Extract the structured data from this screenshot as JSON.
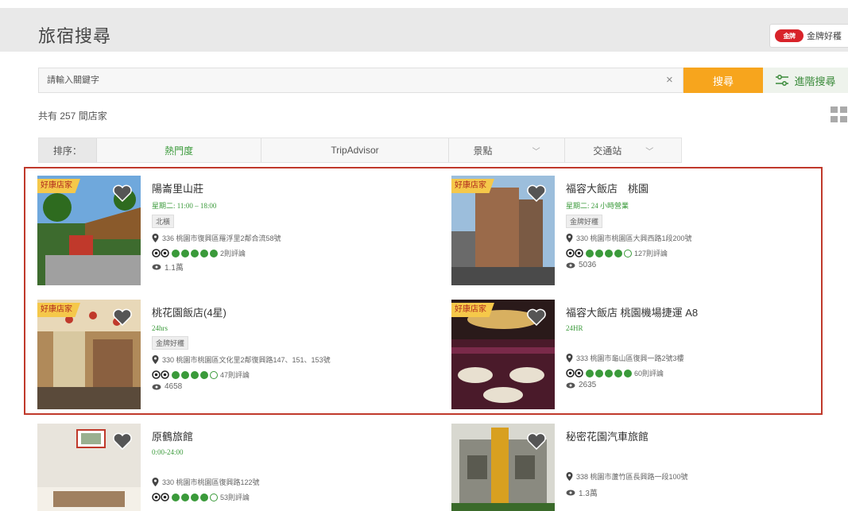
{
  "header": {
    "title": "旅宿搜尋",
    "brand_label": "金牌好穫",
    "brand_logo_text": "金牌"
  },
  "search": {
    "placeholder": "請輸入關鍵字",
    "clear_label": "×",
    "search_label": "搜尋",
    "advanced_label": "進階搜尋"
  },
  "results": {
    "count_text": "共有 257 間店家"
  },
  "sort": {
    "label": "排序：",
    "options": [
      "熱門度",
      "TripAdvisor",
      "景點",
      "交通站"
    ]
  },
  "colors": {
    "accent_orange": "#f7a51d",
    "accent_green": "#3a9a3a",
    "highlight_red": "#c0392b",
    "badge_yellow": "#f5c84a"
  },
  "cards": [
    {
      "badge": "好康店家",
      "title": "陽崙里山莊",
      "hours": "星期二: 11:00 – 18:00",
      "tag": "北橫",
      "address": "336 桃園市復興區羅浮里2鄰合流58號",
      "reviews": "2則評論",
      "rating": 5,
      "views": "1.1萬"
    },
    {
      "badge": "好康店家",
      "title": "福容大飯店　桃園",
      "hours": "星期二: 24 小時營業",
      "tag": "金牌好穫",
      "address": "330 桃園市桃園區大興西路1段200號",
      "reviews": "127則評論",
      "rating": 4,
      "views": "5036"
    },
    {
      "badge": "好康店家",
      "title": "桃花園飯店(4星)",
      "hours": "24hrs",
      "tag": "金牌好穫",
      "address": "330 桃園市桃園區文化里2鄰復興路147、151、153號",
      "reviews": "47則評論",
      "rating": 4,
      "views": "4658"
    },
    {
      "badge": "好康店家",
      "title": "福容大飯店 桃園機場捷運 A8",
      "hours": "24HR",
      "tag": "",
      "address": "333 桃園市龜山區復興一路2號3樓",
      "reviews": "60則評論",
      "rating": 5,
      "views": "2635"
    },
    {
      "badge": "",
      "title": "原鶴旅館",
      "hours": "0:00-24:00",
      "tag": "",
      "address": "330 桃園市桃園區復興路122號",
      "reviews": "53則評論",
      "rating": 4,
      "views": ""
    },
    {
      "badge": "",
      "title": "秘密花園汽車旅館",
      "hours": "",
      "tag": "",
      "address": "338 桃園市蘆竹區長興路一段100號",
      "reviews": "",
      "rating": 0,
      "views": "1.3萬"
    }
  ]
}
